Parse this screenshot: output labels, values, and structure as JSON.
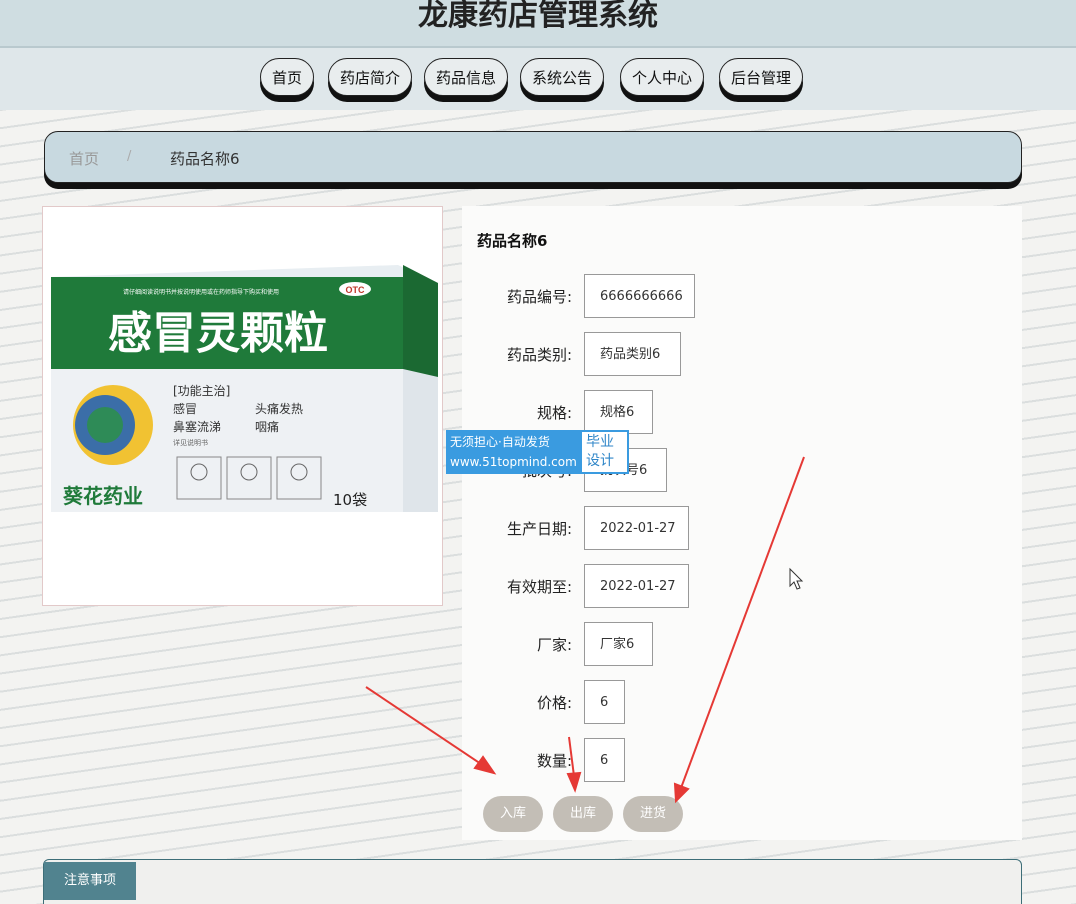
{
  "header": {
    "title": "龙康药店管理系统"
  },
  "nav": {
    "items": [
      "首页",
      "药店简介",
      "药品信息",
      "系统公告",
      "个人中心",
      "后台管理"
    ]
  },
  "breadcrumb": {
    "home": "首页",
    "separator": "/",
    "current": "药品名称6"
  },
  "product": {
    "name": "药品名称6",
    "image": {
      "box_title": "感冒灵颗粒",
      "top_text": "请仔细阅读说明书并按说明使用或在药师指导下购买和使用",
      "otc": "OTC",
      "func_title": "[功能主治]",
      "symptoms": [
        "感冒",
        "头痛发热",
        "鼻塞流涕",
        "咽痛"
      ],
      "note": "详见说明书",
      "brand": "葵花药业",
      "count": "10袋"
    },
    "fields": [
      {
        "label": "药品编号:",
        "value": "6666666666"
      },
      {
        "label": "药品类别:",
        "value": "药品类别6"
      },
      {
        "label": "规格:",
        "value": "规格6"
      },
      {
        "label": "批次号:",
        "value": "批次号6"
      },
      {
        "label": "生产日期:",
        "value": "2022-01-27"
      },
      {
        "label": "有效期至:",
        "value": "2022-01-27"
      },
      {
        "label": "厂家:",
        "value": "厂家6"
      },
      {
        "label": "价格:",
        "value": "6"
      },
      {
        "label": "数量:",
        "value": "6"
      }
    ],
    "actions": [
      "入库",
      "出库",
      "进货"
    ]
  },
  "notice": {
    "tab": "注意事项"
  },
  "watermark": {
    "line1": "无须担心·自动发货",
    "line2": "www.51topmind.com",
    "right1": "毕业",
    "right2": "设计"
  },
  "colors": {
    "header_bg": "#cfdde1",
    "breadcrumb_bg": "#c8d9e0",
    "button_bg": "#c3beb6",
    "notice_tab_bg": "#51838f",
    "annotation_arrow": "#e53935"
  }
}
